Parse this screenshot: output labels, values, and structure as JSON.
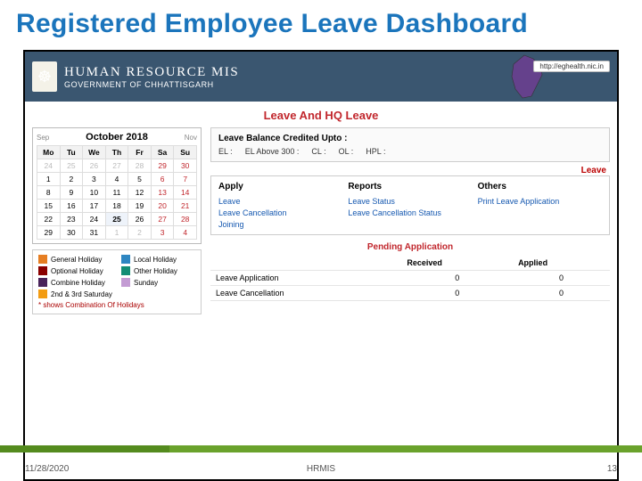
{
  "slide": {
    "title": "Registered Employee Leave Dashboard",
    "date": "11/28/2020",
    "footer_center": "HRMIS",
    "page_num": "13"
  },
  "header": {
    "main": "HUMAN RESOURCE MIS",
    "sub": "GOVERNMENT OF CHHATTISGARH",
    "url": "http://eghealth.nic.in"
  },
  "section": {
    "title": "Leave And HQ Leave",
    "leave_label": "Leave",
    "pending_label": "Pending Application"
  },
  "calendar": {
    "prev": "Sep",
    "month": "October 2018",
    "next": "Nov",
    "dow": [
      "Mo",
      "Tu",
      "We",
      "Th",
      "Fr",
      "Sa",
      "Su"
    ],
    "weeks": [
      [
        "24",
        "25",
        "26",
        "27",
        "28",
        "29",
        "30"
      ],
      [
        "1",
        "2",
        "3",
        "4",
        "5",
        "6",
        "7"
      ],
      [
        "8",
        "9",
        "10",
        "11",
        "12",
        "13",
        "14"
      ],
      [
        "15",
        "16",
        "17",
        "18",
        "19",
        "20",
        "21"
      ],
      [
        "22",
        "23",
        "24",
        "25",
        "26",
        "27",
        "28"
      ],
      [
        "29",
        "30",
        "31",
        "1",
        "2",
        "3",
        "4"
      ]
    ],
    "selected": "25"
  },
  "legend": {
    "items": [
      {
        "color": "#e67e22",
        "label": "General Holiday"
      },
      {
        "color": "#2e86c1",
        "label": "Local Holiday"
      },
      {
        "color": "#8b0000",
        "label": "Optional Holiday"
      },
      {
        "color": "#138d75",
        "label": "Other Holiday"
      },
      {
        "color": "#4a235a",
        "label": "Combine Holiday"
      },
      {
        "color": "#c39bd3",
        "label": "Sunday"
      },
      {
        "color": "#f39c12",
        "label": "2nd & 3rd Saturday"
      }
    ],
    "note": "* shows Combination Of Holidays"
  },
  "balance": {
    "head": "Leave Balance Credited Upto :",
    "items": [
      "EL :",
      "EL Above 300 :",
      "CL :",
      "OL :",
      "HPL :"
    ]
  },
  "columns": {
    "heads": [
      "Apply",
      "Reports",
      "Others"
    ],
    "rows": [
      [
        "Leave",
        "Leave Status",
        "Print Leave Application"
      ],
      [
        "Leave Cancellation",
        "Leave Cancellation Status",
        ""
      ],
      [
        "Joining",
        "",
        ""
      ]
    ]
  },
  "pending": {
    "heads": [
      "",
      "Received",
      "Applied"
    ],
    "rows": [
      [
        "Leave Application",
        "0",
        "0"
      ],
      [
        "Leave Cancellation",
        "0",
        "0"
      ]
    ]
  }
}
